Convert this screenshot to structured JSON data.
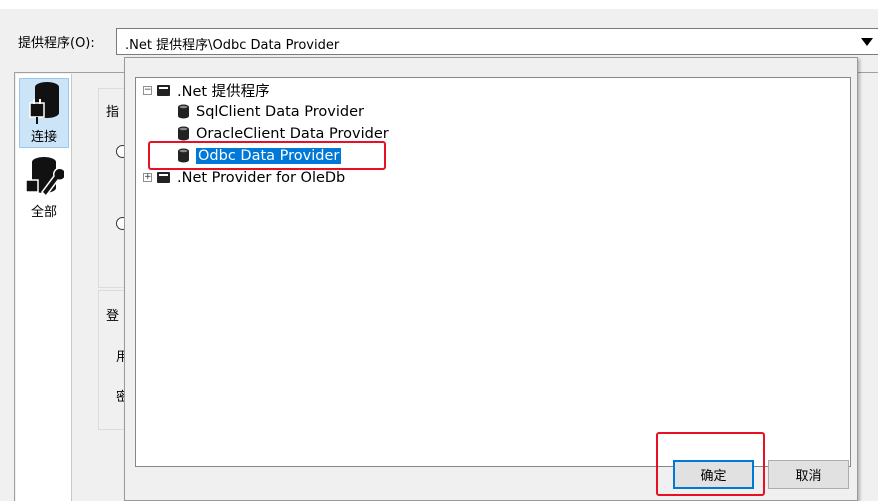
{
  "provider": {
    "label": "提供程序(O):",
    "value": ".Net 提供程序\\Odbc Data Provider"
  },
  "nav": [
    {
      "label": "连接",
      "icon": "database-plug-icon",
      "selected": true
    },
    {
      "label": "全部",
      "icon": "database-wrench-icon",
      "selected": false
    }
  ],
  "background_fragments": {
    "specify": "指",
    "login": "登",
    "user": "用",
    "password": "密"
  },
  "tree": {
    "root1": ".Net 提供程序",
    "children": [
      "SqlClient Data Provider",
      "OracleClient Data Provider",
      "Odbc Data Provider"
    ],
    "root2": ".Net Provider for OleDb"
  },
  "buttons": {
    "ok": "确定",
    "cancel": "取消"
  },
  "colors": {
    "selection": "#0078d7",
    "highlight_box": "#e81123"
  }
}
